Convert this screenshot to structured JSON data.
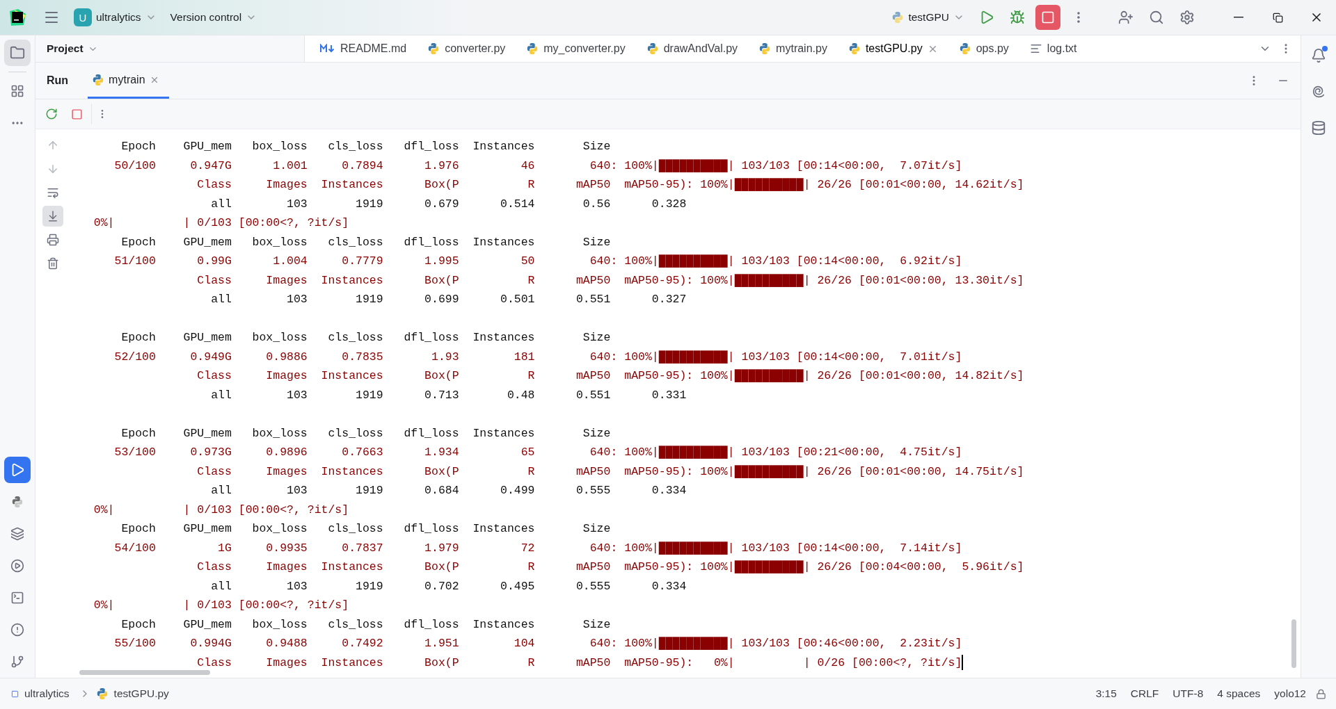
{
  "title_bar": {
    "project_badge": "U",
    "project": "ultralytics",
    "vcs": "Version control",
    "run_config": "testGPU"
  },
  "project_panel": {
    "title": "Project"
  },
  "editor_tabs": [
    {
      "label": "README.md",
      "kind": "markdown",
      "selected": false
    },
    {
      "label": "converter.py",
      "kind": "python",
      "selected": false
    },
    {
      "label": "my_converter.py",
      "kind": "python",
      "selected": false
    },
    {
      "label": "drawAndVal.py",
      "kind": "python",
      "selected": false
    },
    {
      "label": "mytrain.py",
      "kind": "python",
      "selected": false
    },
    {
      "label": "testGPU.py",
      "kind": "python",
      "selected": true
    },
    {
      "label": "ops.py",
      "kind": "python",
      "selected": false
    },
    {
      "label": "log.txt",
      "kind": "text",
      "selected": false
    }
  ],
  "run_window": {
    "title": "Run",
    "tabs": [
      {
        "label": "mytrain",
        "selected": true
      }
    ]
  },
  "console": {
    "caret": true,
    "lines": [
      {
        "kind": "header",
        "text": "      Epoch    GPU_mem   box_loss   cls_loss   dfl_loss  Instances       Size"
      },
      {
        "kind": "progress",
        "text": "     50/100     0.947G      1.001     0.7894      1.976         46        640: 100%|██████████| 103/103 [00:14<00:00,  7.07it/s]"
      },
      {
        "kind": "progress",
        "text": "                 Class     Images  Instances      Box(P          R      mAP50  mAP50-95): 100%|██████████| 26/26 [00:01<00:00, 14.62it/s]"
      },
      {
        "kind": "metrics",
        "text": "                   all        103       1919      0.679      0.514       0.56      0.328"
      },
      {
        "kind": "progress",
        "text": "  0%|          | 0/103 [00:00<?, ?it/s]"
      },
      {
        "kind": "header",
        "text": "      Epoch    GPU_mem   box_loss   cls_loss   dfl_loss  Instances       Size"
      },
      {
        "kind": "progress",
        "text": "     51/100      0.99G      1.004     0.7779      1.995         50        640: 100%|██████████| 103/103 [00:14<00:00,  6.92it/s]"
      },
      {
        "kind": "progress",
        "text": "                 Class     Images  Instances      Box(P          R      mAP50  mAP50-95): 100%|██████████| 26/26 [00:01<00:00, 13.30it/s]"
      },
      {
        "kind": "metrics",
        "text": "                   all        103       1919      0.699      0.501      0.551      0.327"
      },
      {
        "kind": "blank"
      },
      {
        "kind": "header",
        "text": "      Epoch    GPU_mem   box_loss   cls_loss   dfl_loss  Instances       Size"
      },
      {
        "kind": "progress",
        "text": "     52/100     0.949G     0.9886     0.7835       1.93        181        640: 100%|██████████| 103/103 [00:14<00:00,  7.01it/s]"
      },
      {
        "kind": "progress",
        "text": "                 Class     Images  Instances      Box(P          R      mAP50  mAP50-95): 100%|██████████| 26/26 [00:01<00:00, 14.82it/s]"
      },
      {
        "kind": "metrics",
        "text": "                   all        103       1919      0.713       0.48      0.551      0.331"
      },
      {
        "kind": "blank"
      },
      {
        "kind": "header",
        "text": "      Epoch    GPU_mem   box_loss   cls_loss   dfl_loss  Instances       Size"
      },
      {
        "kind": "progress",
        "text": "     53/100     0.973G     0.9896     0.7663      1.934         65        640: 100%|██████████| 103/103 [00:21<00:00,  4.75it/s]"
      },
      {
        "kind": "progress",
        "text": "                 Class     Images  Instances      Box(P          R      mAP50  mAP50-95): 100%|██████████| 26/26 [00:01<00:00, 14.75it/s]"
      },
      {
        "kind": "metrics",
        "text": "                   all        103       1919      0.684      0.499      0.555      0.334"
      },
      {
        "kind": "progress",
        "text": "  0%|          | 0/103 [00:00<?, ?it/s]"
      },
      {
        "kind": "header",
        "text": "      Epoch    GPU_mem   box_loss   cls_loss   dfl_loss  Instances       Size"
      },
      {
        "kind": "progress",
        "text": "     54/100         1G     0.9935     0.7837      1.979         72        640: 100%|██████████| 103/103 [00:14<00:00,  7.14it/s]"
      },
      {
        "kind": "progress",
        "text": "                 Class     Images  Instances      Box(P          R      mAP50  mAP50-95): 100%|██████████| 26/26 [00:04<00:00,  5.96it/s]"
      },
      {
        "kind": "metrics",
        "text": "                   all        103       1919      0.702      0.495      0.555      0.334"
      },
      {
        "kind": "progress",
        "text": "  0%|          | 0/103 [00:00<?, ?it/s]"
      },
      {
        "kind": "header",
        "text": "      Epoch    GPU_mem   box_loss   cls_loss   dfl_loss  Instances       Size"
      },
      {
        "kind": "progress",
        "text": "     55/100     0.994G     0.9488     0.7492      1.951        104        640: 100%|██████████| 103/103 [00:46<00:00,  2.23it/s]"
      },
      {
        "kind": "progress",
        "text": "                 Class     Images  Instances      Box(P          R      mAP50  mAP50-95):   0%|          | 0/26 [00:00<?, ?it/s]"
      }
    ]
  },
  "status_bar": {
    "breadcrumbs": [
      "ultralytics",
      "testGPU.py"
    ],
    "items": [
      "3:15",
      "CRLF",
      "UTF-8",
      "4 spaces",
      "yolo12"
    ]
  }
}
